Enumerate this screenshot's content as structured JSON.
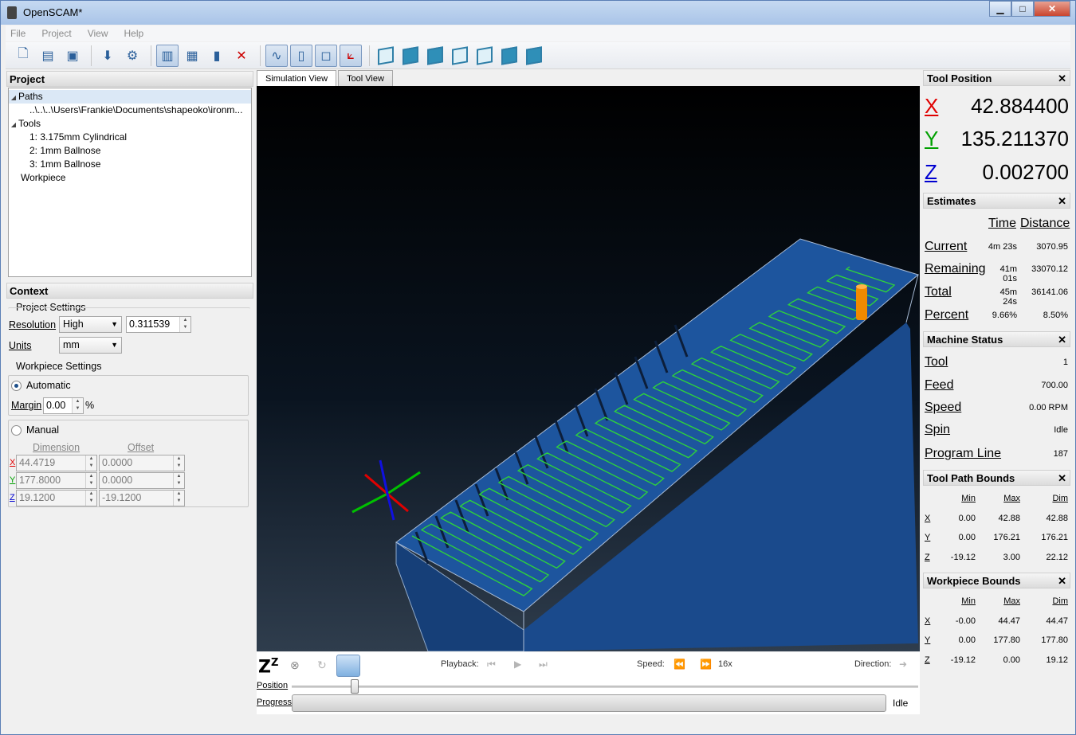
{
  "window": {
    "title": "OpenSCAM*",
    "minimize": "▁",
    "maximize": "□",
    "close": "✕"
  },
  "menu": [
    "File",
    "Project",
    "View",
    "Help"
  ],
  "toolbar": {
    "icons": [
      "new-project-icon",
      "open-project-icon",
      "save-icon",
      "export-icon",
      "settings-icon",
      "surface-view-icon",
      "wireframe-view-icon",
      "workpiece-view-icon",
      "hide-icon",
      "toolpath-icon",
      "tool-icon",
      "bounds-icon",
      "axes-icon",
      "iso-view-icon",
      "front-view-icon",
      "top-view-icon",
      "right-view-icon",
      "back-view-icon",
      "left-view-icon",
      "bottom-view-icon"
    ]
  },
  "project_panel": {
    "title": "Project",
    "tree": {
      "paths_label": "Paths",
      "path_item": "..\\..\\..\\Users\\Frankie\\Documents\\shapeoko\\ironm...",
      "tools_label": "Tools",
      "tools": [
        "1: 3.175mm Cylindrical",
        "2: 1mm Ballnose",
        "3: 1mm Ballnose"
      ],
      "workpiece_label": "Workpiece"
    }
  },
  "context_panel": {
    "title": "Context",
    "project_settings": {
      "label": "Project Settings",
      "resolution_label": "Resolution",
      "resolution_mode": "High",
      "resolution_value": "0.311539",
      "units_label": "Units",
      "units_value": "mm"
    },
    "workpiece_settings": {
      "label": "Workpiece Settings",
      "automatic_label": "Automatic",
      "margin_label": "Margin",
      "margin_value": "0.00",
      "margin_unit": "%",
      "manual_label": "Manual",
      "dimension_header": "Dimension",
      "offset_header": "Offset",
      "rows": [
        {
          "axis": "X",
          "dimension": "44.4719",
          "offset": "0.0000"
        },
        {
          "axis": "Y",
          "dimension": "177.8000",
          "offset": "0.0000"
        },
        {
          "axis": "Z",
          "dimension": "19.1200",
          "offset": "-19.1200"
        }
      ]
    }
  },
  "tabs": [
    "Simulation View",
    "Tool View"
  ],
  "playback": {
    "sleep_label": "Z",
    "sleep_sup": "Z",
    "playback_label": "Playback:",
    "speed_label": "Speed:",
    "speed_value": "16x",
    "direction_label": "Direction:",
    "position_label": "Position",
    "position_fraction": 0.1,
    "progress_label": "Progress",
    "progress_status": "Idle"
  },
  "tool_position": {
    "title": "Tool Position",
    "x_label": "X",
    "x_value": "42.884400",
    "y_label": "Y",
    "y_value": "135.211370",
    "z_label": "Z",
    "z_value": "0.002700"
  },
  "estimates": {
    "title": "Estimates",
    "time_header": "Time",
    "distance_header": "Distance",
    "rows": [
      {
        "label": "Current",
        "time": "4m 23s",
        "distance": "3070.95"
      },
      {
        "label": "Remaining",
        "time": "41m 01s",
        "distance": "33070.12"
      },
      {
        "label": "Total",
        "time": "45m 24s",
        "distance": "36141.06"
      },
      {
        "label": "Percent",
        "time": "9.66%",
        "distance": "8.50%"
      }
    ]
  },
  "machine_status": {
    "title": "Machine Status",
    "rows": [
      {
        "label": "Tool",
        "value": "1"
      },
      {
        "label": "Feed",
        "value": "700.00"
      },
      {
        "label": "Speed",
        "value": "0.00 RPM"
      },
      {
        "label": "Spin",
        "value": "Idle"
      },
      {
        "label": "Program Line",
        "value": "187"
      }
    ]
  },
  "tool_path_bounds": {
    "title": "Tool Path Bounds",
    "headers": [
      "Min",
      "Max",
      "Dim"
    ],
    "rows": [
      {
        "axis": "X",
        "min": "0.00",
        "max": "42.88",
        "dim": "42.88"
      },
      {
        "axis": "Y",
        "min": "0.00",
        "max": "176.21",
        "dim": "176.21"
      },
      {
        "axis": "Z",
        "min": "-19.12",
        "max": "3.00",
        "dim": "22.12"
      }
    ]
  },
  "workpiece_bounds": {
    "title": "Workpiece Bounds",
    "headers": [
      "Min",
      "Max",
      "Dim"
    ],
    "rows": [
      {
        "axis": "X",
        "min": "-0.00",
        "max": "44.47",
        "dim": "44.47"
      },
      {
        "axis": "Y",
        "min": "0.00",
        "max": "177.80",
        "dim": "177.80"
      },
      {
        "axis": "Z",
        "min": "-19.12",
        "max": "0.00",
        "dim": "19.12"
      }
    ]
  },
  "colors": {
    "x_axis": "#e00000",
    "y_axis": "#00a000",
    "z_axis": "#0000d0",
    "toolpath": "#2ed13c",
    "workpiece": "#1c4f8f",
    "tool": "#f08a00"
  },
  "panel_close": "✕"
}
